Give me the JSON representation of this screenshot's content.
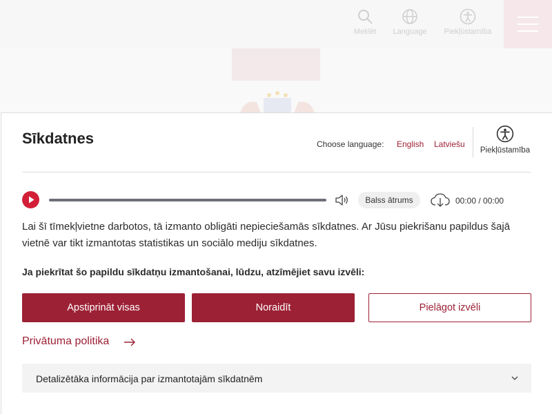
{
  "site_header": {
    "search_label": "Meklēt",
    "language_label": "Language",
    "accessibility_label": "Piekļūstamība"
  },
  "cookie_panel": {
    "title": "Sīkdatnes",
    "choose_language_label": "Choose language:",
    "languages": [
      "English",
      "Latviešu"
    ],
    "accessibility_label": "Piekļūstamība",
    "audio": {
      "speed_label": "Balss ātrums",
      "time": "00:00 / 00:00",
      "progress": 0
    },
    "description": "Lai šī tīmekļvietne darbotos, tā izmanto obligāti nepieciešamās sīkdatnes. Ar Jūsu piekrišanu papildus šajā vietnē var tikt izmantotas statistikas un sociālo mediju sīkdatnes.",
    "prompt": "Ja piekrītat šo papildu sīkdatņu izmantošanai, lūdzu, atzīmējiet savu izvēli:",
    "buttons": {
      "accept_all": "Apstiprināt visas",
      "reject": "Noraidīt",
      "customize": "Pielāgot izvēli"
    },
    "privacy_link": "Privātuma politika",
    "accordion_label": "Detalizētāka informācija par izmantotajām sīkdatnēm"
  },
  "colors": {
    "brand": "#9c2135",
    "play": "#d21f37",
    "link": "#9e2035"
  },
  "icons": [
    "search-icon",
    "globe-icon",
    "accessibility-icon",
    "menu-icon",
    "play-icon",
    "volume-icon",
    "download-icon",
    "arrow-right-icon",
    "chevron-down-icon"
  ]
}
